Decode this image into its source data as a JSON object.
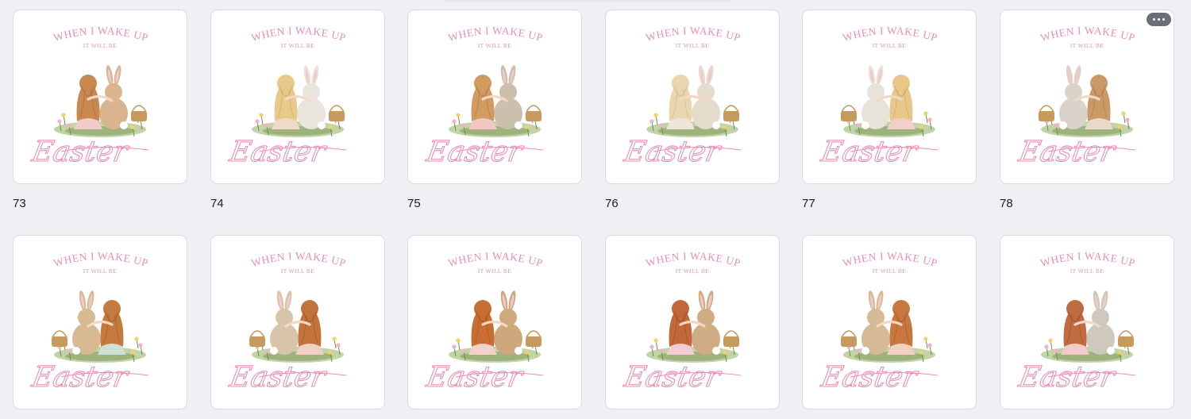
{
  "pages": [
    {
      "number": "73",
      "title_top": "WHEN I WAKE UP",
      "title_mid": "IT WILL BE",
      "title_script": "Easter",
      "hair": "#c9884f",
      "hair_dark": "#a7683a",
      "dress": "#f1cbc9",
      "bunny": "#d9b48e",
      "bunny_side": "right",
      "image": "girl-and-bunny-illustration"
    },
    {
      "number": "74",
      "title_top": "WHEN I WAKE UP",
      "title_mid": "IT WILL BE",
      "title_script": "Easter",
      "hair": "#e7c98a",
      "hair_dark": "#caa765",
      "dress": "#f1d9c8",
      "bunny": "#e9e4dc",
      "bunny_side": "right",
      "image": "girl-and-bunny-illustration"
    },
    {
      "number": "75",
      "title_top": "WHEN I WAKE UP",
      "title_mid": "IT WILL BE",
      "title_script": "Easter",
      "hair": "#d19a60",
      "hair_dark": "#ad7842",
      "dress": "#f0c7c3",
      "bunny": "#cbbfae",
      "bunny_side": "right",
      "image": "girl-and-bunny-illustration"
    },
    {
      "number": "76",
      "title_top": "WHEN I WAKE UP",
      "title_mid": "IT WILL BE",
      "title_script": "Easter",
      "hair": "#e9d6ae",
      "hair_dark": "#cbb68a",
      "dress": "#efe6da",
      "bunny": "#e6dccd",
      "bunny_side": "right",
      "image": "girl-and-bunny-illustration"
    },
    {
      "number": "77",
      "title_top": "WHEN I WAKE UP",
      "title_mid": "IT WILL BE",
      "title_script": "Easter",
      "hair": "#e8c789",
      "hair_dark": "#c9a464",
      "dress": "#f2cfc9",
      "bunny": "#e7e2da",
      "bunny_side": "left",
      "image": "girl-and-bunny-illustration"
    },
    {
      "number": "78",
      "title_top": "WHEN I WAKE UP",
      "title_mid": "IT WILL BE",
      "title_script": "Easter",
      "hair": "#c99a66",
      "hair_dark": "#a67b4b",
      "dress": "#ecd8c9",
      "bunny": "#d9d3c9",
      "bunny_side": "left",
      "image": "girl-and-bunny-illustration"
    },
    {
      "number": "",
      "title_top": "WHEN I WAKE UP",
      "title_mid": "IT WILL BE",
      "title_script": "Easter",
      "hair": "#c57a3d",
      "hair_dark": "#9e5a27",
      "dress": "#cfe0d6",
      "bunny": "#d7b994",
      "bunny_side": "left",
      "image": "girl-and-bunny-illustration"
    },
    {
      "number": "",
      "title_top": "WHEN I WAKE UP",
      "title_mid": "IT WILL BE",
      "title_script": "Easter",
      "hair": "#c2733a",
      "hair_dark": "#9a5425",
      "dress": "#f0cfc4",
      "bunny": "#d8c4a8",
      "bunny_side": "left",
      "image": "girl-and-bunny-illustration"
    },
    {
      "number": "",
      "title_top": "WHEN I WAKE UP",
      "title_mid": "IT WILL BE",
      "title_script": "Easter",
      "hair": "#c76e32",
      "hair_dark": "#a1521f",
      "dress": "#f2d3c9",
      "bunny": "#cfa77c",
      "bunny_side": "right",
      "image": "girl-and-bunny-illustration"
    },
    {
      "number": "",
      "title_top": "WHEN I WAKE UP",
      "title_mid": "IT WILL BE",
      "title_script": "Easter",
      "hair": "#c0683a",
      "hair_dark": "#974b22",
      "dress": "#f0cdd2",
      "bunny": "#d0ac84",
      "bunny_side": "right",
      "image": "girl-and-bunny-illustration"
    },
    {
      "number": "",
      "title_top": "WHEN I WAKE UP",
      "title_mid": "IT WILL BE",
      "title_script": "Easter",
      "hair": "#c8773f",
      "hair_dark": "#a05a2a",
      "dress": "#f1d2c2",
      "bunny": "#d6ba96",
      "bunny_side": "left",
      "image": "girl-and-bunny-illustration"
    },
    {
      "number": "",
      "title_top": "WHEN I WAKE UP",
      "title_mid": "IT WILL BE",
      "title_script": "Easter",
      "hair": "#c06c40",
      "hair_dark": "#96502a",
      "dress": "#f0cbc8",
      "bunny": "#cfc8bd",
      "bunny_side": "right",
      "image": "girl-and-bunny-illustration"
    }
  ],
  "more_button": {
    "icon": "more-horizontal-icon"
  },
  "colors": {
    "background": "#eff0f3",
    "title_pink": "#ea8fb2",
    "grass": "#8fae5e",
    "leaf_dark": "#6f8f47",
    "flower_pink": "#f3b2c6",
    "flower_yellow": "#f2d36b",
    "basket": "#c69a5f"
  }
}
